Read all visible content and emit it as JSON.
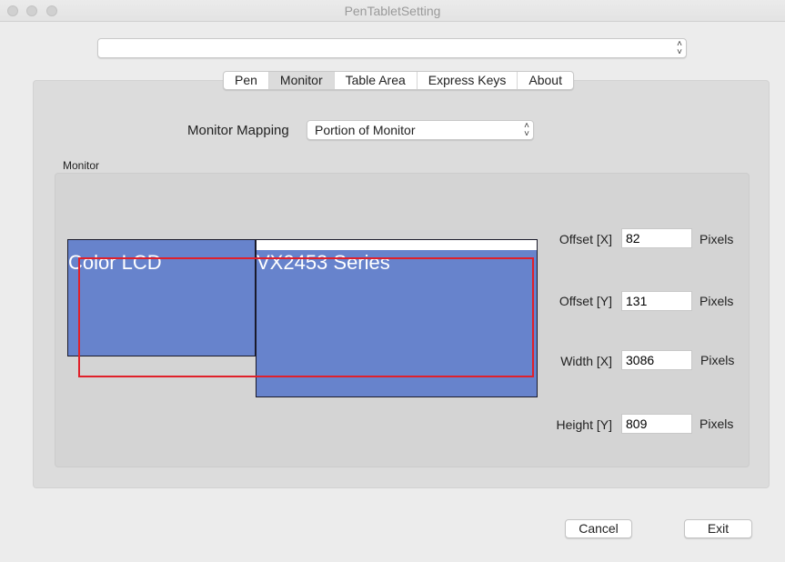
{
  "window": {
    "title": "PenTabletSetting"
  },
  "device_select": {
    "value": ""
  },
  "tabs": [
    {
      "label": "Pen"
    },
    {
      "label": "Monitor",
      "selected": true
    },
    {
      "label": "Table Area"
    },
    {
      "label": "Express Keys"
    },
    {
      "label": "About"
    }
  ],
  "mapping": {
    "label": "Monitor Mapping",
    "value": "Portion of Monitor"
  },
  "monitor_group": {
    "label": "Monitor",
    "displays": [
      {
        "name": "Color LCD"
      },
      {
        "name": "VX2453 Series"
      }
    ],
    "display_color": "#6783cc",
    "mapping_color": "#e0202a"
  },
  "fields": [
    {
      "label": "Offset [X]",
      "value": "82",
      "unit": "Pixels"
    },
    {
      "label": "Offset [Y]",
      "value": "131",
      "unit": "Pixels"
    },
    {
      "label": "Width [X]",
      "value": "3086",
      "unit": "Pixels"
    },
    {
      "label": "Height [Y]",
      "value": "809",
      "unit": "Pixels"
    }
  ],
  "buttons": {
    "cancel": "Cancel",
    "exit": "Exit"
  }
}
